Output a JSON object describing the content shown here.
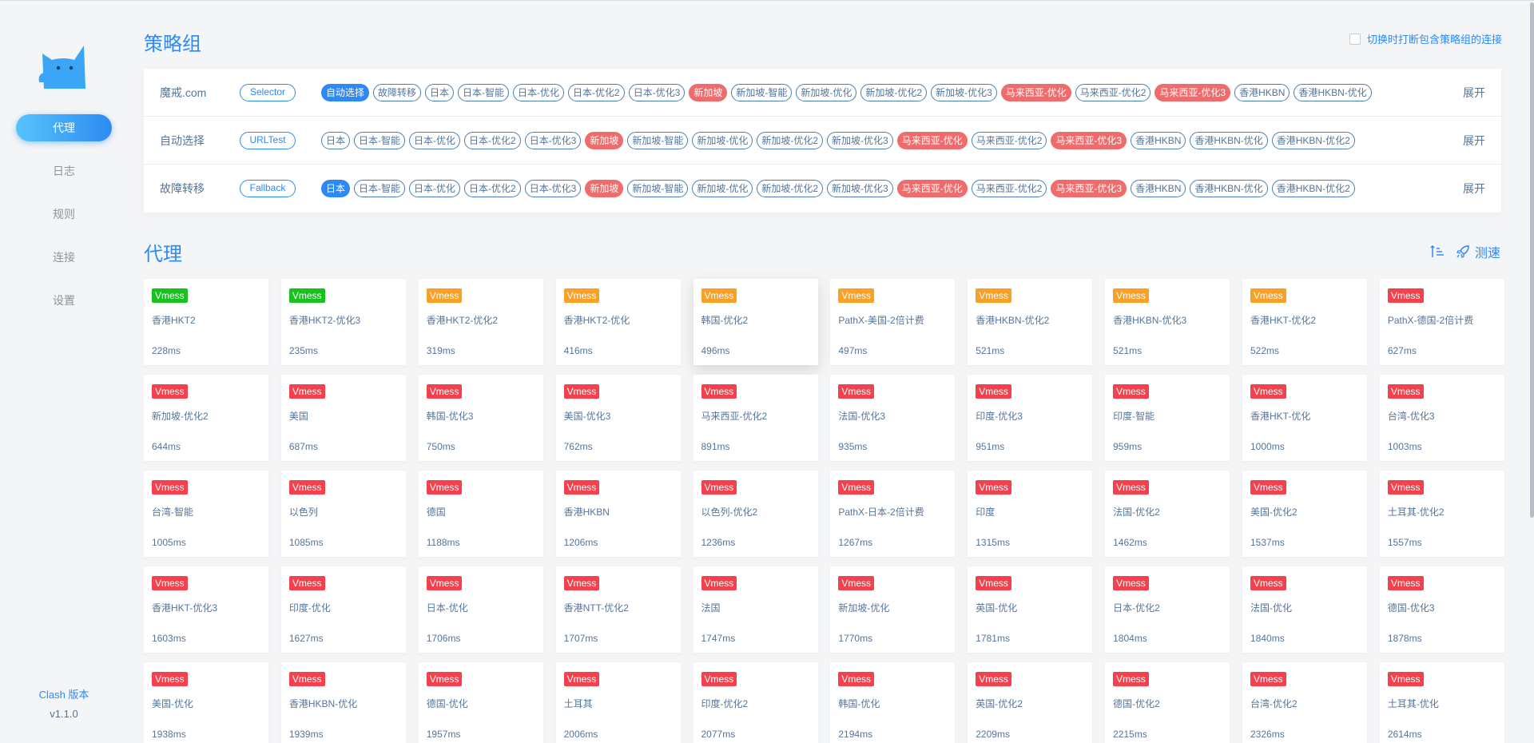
{
  "colors": {
    "accent": "#2c8af8",
    "text": "#54759a",
    "tag_highlight": "#f06b6b",
    "badge_green": "#18c11d",
    "badge_orange": "#f9a025",
    "badge_red": "#f5404e"
  },
  "sidebar": {
    "items": [
      {
        "label": "代理",
        "active": true
      },
      {
        "label": "日志",
        "active": false
      },
      {
        "label": "规则",
        "active": false
      },
      {
        "label": "连接",
        "active": false
      },
      {
        "label": "设置",
        "active": false
      }
    ],
    "version_label": "Clash 版本",
    "version_value": "v1.1.0"
  },
  "groups_section": {
    "title": "策略组",
    "break_option": "切换时打断包含策略组的连接",
    "expand_label": "展开",
    "groups": [
      {
        "name": "魔戒.com",
        "type": "Selector",
        "tags": [
          {
            "label": "自动选择",
            "state": "selected"
          },
          {
            "label": "故障转移",
            "state": ""
          },
          {
            "label": "日本",
            "state": ""
          },
          {
            "label": "日本-智能",
            "state": ""
          },
          {
            "label": "日本-优化",
            "state": ""
          },
          {
            "label": "日本-优化2",
            "state": ""
          },
          {
            "label": "日本-优化3",
            "state": ""
          },
          {
            "label": "新加坡",
            "state": "highlight"
          },
          {
            "label": "新加坡-智能",
            "state": ""
          },
          {
            "label": "新加坡-优化",
            "state": ""
          },
          {
            "label": "新加坡-优化2",
            "state": ""
          },
          {
            "label": "新加坡-优化3",
            "state": ""
          },
          {
            "label": "马来西亚-优化",
            "state": "highlight"
          },
          {
            "label": "马来西亚-优化2",
            "state": ""
          },
          {
            "label": "马来西亚-优化3",
            "state": "highlight"
          },
          {
            "label": "香港HKBN",
            "state": ""
          },
          {
            "label": "香港HKBN-优化",
            "state": ""
          }
        ]
      },
      {
        "name": "自动选择",
        "type": "URLTest",
        "tags": [
          {
            "label": "日本",
            "state": ""
          },
          {
            "label": "日本-智能",
            "state": ""
          },
          {
            "label": "日本-优化",
            "state": ""
          },
          {
            "label": "日本-优化2",
            "state": ""
          },
          {
            "label": "日本-优化3",
            "state": ""
          },
          {
            "label": "新加坡",
            "state": "highlight"
          },
          {
            "label": "新加坡-智能",
            "state": ""
          },
          {
            "label": "新加坡-优化",
            "state": ""
          },
          {
            "label": "新加坡-优化2",
            "state": ""
          },
          {
            "label": "新加坡-优化3",
            "state": ""
          },
          {
            "label": "马来西亚-优化",
            "state": "highlight"
          },
          {
            "label": "马来西亚-优化2",
            "state": ""
          },
          {
            "label": "马来西亚-优化3",
            "state": "highlight"
          },
          {
            "label": "香港HKBN",
            "state": ""
          },
          {
            "label": "香港HKBN-优化",
            "state": ""
          },
          {
            "label": "香港HKBN-优化2",
            "state": ""
          }
        ]
      },
      {
        "name": "故障转移",
        "type": "Fallback",
        "tags": [
          {
            "label": "日本",
            "state": "selected"
          },
          {
            "label": "日本-智能",
            "state": ""
          },
          {
            "label": "日本-优化",
            "state": ""
          },
          {
            "label": "日本-优化2",
            "state": ""
          },
          {
            "label": "日本-优化3",
            "state": ""
          },
          {
            "label": "新加坡",
            "state": "highlight"
          },
          {
            "label": "新加坡-智能",
            "state": ""
          },
          {
            "label": "新加坡-优化",
            "state": ""
          },
          {
            "label": "新加坡-优化2",
            "state": ""
          },
          {
            "label": "新加坡-优化3",
            "state": ""
          },
          {
            "label": "马来西亚-优化",
            "state": "highlight"
          },
          {
            "label": "马来西亚-优化2",
            "state": ""
          },
          {
            "label": "马来西亚-优化3",
            "state": "highlight"
          },
          {
            "label": "香港HKBN",
            "state": ""
          },
          {
            "label": "香港HKBN-优化",
            "state": ""
          },
          {
            "label": "香港HKBN-优化2",
            "state": ""
          }
        ]
      }
    ]
  },
  "proxies_section": {
    "title": "代理",
    "speed_test_label": "测速",
    "proxies": [
      {
        "type": "Vmess",
        "color": "green",
        "name": "香港HKT2",
        "delay": "228ms"
      },
      {
        "type": "Vmess",
        "color": "green",
        "name": "香港HKT2-优化3",
        "delay": "235ms"
      },
      {
        "type": "Vmess",
        "color": "orange",
        "name": "香港HKT2-优化2",
        "delay": "319ms"
      },
      {
        "type": "Vmess",
        "color": "orange",
        "name": "香港HKT2-优化",
        "delay": "416ms"
      },
      {
        "type": "Vmess",
        "color": "orange",
        "name": "韩国-优化2",
        "delay": "496ms"
      },
      {
        "type": "Vmess",
        "color": "orange",
        "name": "PathX-美国-2倍计费",
        "delay": "497ms"
      },
      {
        "type": "Vmess",
        "color": "orange",
        "name": "香港HKBN-优化2",
        "delay": "521ms"
      },
      {
        "type": "Vmess",
        "color": "orange",
        "name": "香港HKBN-优化3",
        "delay": "521ms"
      },
      {
        "type": "Vmess",
        "color": "orange",
        "name": "香港HKT-优化2",
        "delay": "522ms"
      },
      {
        "type": "Vmess",
        "color": "red",
        "name": "PathX-德国-2倍计费",
        "delay": "627ms"
      },
      {
        "type": "Vmess",
        "color": "red",
        "name": "新加坡-优化2",
        "delay": "644ms"
      },
      {
        "type": "Vmess",
        "color": "red",
        "name": "美国",
        "delay": "687ms"
      },
      {
        "type": "Vmess",
        "color": "red",
        "name": "韩国-优化3",
        "delay": "750ms"
      },
      {
        "type": "Vmess",
        "color": "red",
        "name": "美国-优化3",
        "delay": "762ms"
      },
      {
        "type": "Vmess",
        "color": "red",
        "name": "马来西亚-优化2",
        "delay": "891ms"
      },
      {
        "type": "Vmess",
        "color": "red",
        "name": "法国-优化3",
        "delay": "935ms"
      },
      {
        "type": "Vmess",
        "color": "red",
        "name": "印度-优化3",
        "delay": "951ms"
      },
      {
        "type": "Vmess",
        "color": "red",
        "name": "印度-智能",
        "delay": "959ms"
      },
      {
        "type": "Vmess",
        "color": "red",
        "name": "香港HKT-优化",
        "delay": "1000ms"
      },
      {
        "type": "Vmess",
        "color": "red",
        "name": "台湾-优化3",
        "delay": "1003ms"
      },
      {
        "type": "Vmess",
        "color": "red",
        "name": "台湾-智能",
        "delay": "1005ms"
      },
      {
        "type": "Vmess",
        "color": "red",
        "name": "以色列",
        "delay": "1085ms"
      },
      {
        "type": "Vmess",
        "color": "red",
        "name": "德国",
        "delay": "1188ms"
      },
      {
        "type": "Vmess",
        "color": "red",
        "name": "香港HKBN",
        "delay": "1206ms"
      },
      {
        "type": "Vmess",
        "color": "red",
        "name": "以色列-优化2",
        "delay": "1236ms"
      },
      {
        "type": "Vmess",
        "color": "red",
        "name": "PathX-日本-2倍计费",
        "delay": "1267ms"
      },
      {
        "type": "Vmess",
        "color": "red",
        "name": "印度",
        "delay": "1315ms"
      },
      {
        "type": "Vmess",
        "color": "red",
        "name": "法国-优化2",
        "delay": "1462ms"
      },
      {
        "type": "Vmess",
        "color": "red",
        "name": "美国-优化2",
        "delay": "1537ms"
      },
      {
        "type": "Vmess",
        "color": "red",
        "name": "土耳其-优化2",
        "delay": "1557ms"
      },
      {
        "type": "Vmess",
        "color": "red",
        "name": "香港HKT-优化3",
        "delay": "1603ms"
      },
      {
        "type": "Vmess",
        "color": "red",
        "name": "印度-优化",
        "delay": "1627ms"
      },
      {
        "type": "Vmess",
        "color": "red",
        "name": "日本-优化",
        "delay": "1706ms"
      },
      {
        "type": "Vmess",
        "color": "red",
        "name": "香港NTT-优化2",
        "delay": "1707ms"
      },
      {
        "type": "Vmess",
        "color": "red",
        "name": "法国",
        "delay": "1747ms"
      },
      {
        "type": "Vmess",
        "color": "red",
        "name": "新加坡-优化",
        "delay": "1770ms"
      },
      {
        "type": "Vmess",
        "color": "red",
        "name": "英国-优化",
        "delay": "1781ms"
      },
      {
        "type": "Vmess",
        "color": "red",
        "name": "日本-优化2",
        "delay": "1804ms"
      },
      {
        "type": "Vmess",
        "color": "red",
        "name": "法国-优化",
        "delay": "1840ms"
      },
      {
        "type": "Vmess",
        "color": "red",
        "name": "德国-优化3",
        "delay": "1878ms"
      },
      {
        "type": "Vmess",
        "color": "red",
        "name": "美国-优化",
        "delay": "1938ms"
      },
      {
        "type": "Vmess",
        "color": "red",
        "name": "香港HKBN-优化",
        "delay": "1939ms"
      },
      {
        "type": "Vmess",
        "color": "red",
        "name": "德国-优化",
        "delay": "1957ms"
      },
      {
        "type": "Vmess",
        "color": "red",
        "name": "土耳其",
        "delay": "2006ms"
      },
      {
        "type": "Vmess",
        "color": "red",
        "name": "印度-优化2",
        "delay": "2077ms"
      },
      {
        "type": "Vmess",
        "color": "red",
        "name": "韩国-优化",
        "delay": "2194ms"
      },
      {
        "type": "Vmess",
        "color": "red",
        "name": "英国-优化2",
        "delay": "2209ms"
      },
      {
        "type": "Vmess",
        "color": "red",
        "name": "德国-优化2",
        "delay": "2215ms"
      },
      {
        "type": "Vmess",
        "color": "red",
        "name": "台湾-优化2",
        "delay": "2326ms"
      },
      {
        "type": "Vmess",
        "color": "red",
        "name": "土耳其-优化",
        "delay": "2614ms"
      }
    ]
  }
}
